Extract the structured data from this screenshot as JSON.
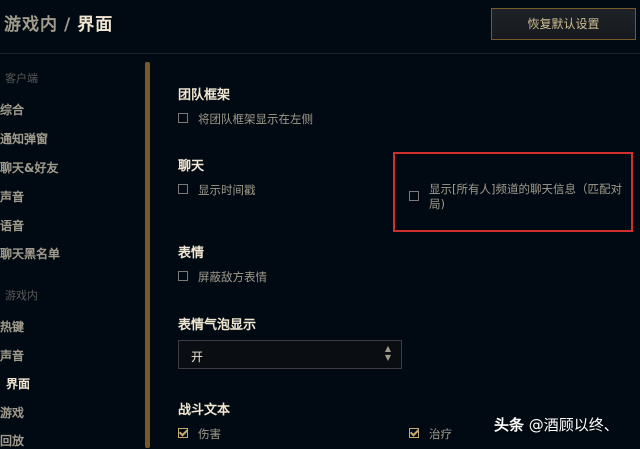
{
  "header": {
    "breadcrumb_parent": "游戏内",
    "breadcrumb_separator": "/",
    "breadcrumb_current": "界面",
    "reset_button": "恢复默认设置"
  },
  "sidebar": {
    "client_group": "客户端",
    "client_items": [
      "综合",
      "通知弹窗",
      "聊天&好友",
      "声音",
      "语音",
      "聊天黑名单"
    ],
    "ingame_group": "游戏内",
    "ingame_items": [
      "热键",
      "声音",
      "界面",
      "游戏",
      "回放"
    ],
    "active_item": "界面"
  },
  "content": {
    "team_frame": {
      "title": "团队框架",
      "option": "将团队框架显示在左侧",
      "checked": false
    },
    "chat": {
      "title": "聊天",
      "option_timestamp": "显示时间戳",
      "timestamp_checked": false,
      "option_all_chat_line1": "显示[所有人]频道的聊天信息（匹配对",
      "option_all_chat_line2": "局)",
      "all_chat_checked": false
    },
    "emotes": {
      "title": "表情",
      "option": "屏蔽敌方表情",
      "checked": false
    },
    "emote_bubble": {
      "title": "表情气泡显示",
      "value": "开"
    },
    "combat_text": {
      "title": "战斗文本",
      "option_damage": "伤害",
      "damage_checked": true,
      "option_heal": "治疗",
      "heal_checked": true
    }
  },
  "watermark": {
    "brand": "头条",
    "handle": "@酒顾以终、"
  },
  "colors": {
    "background": "#010a13",
    "gold_accent": "#c8aa6e",
    "highlight_box": "#d32e2e"
  }
}
